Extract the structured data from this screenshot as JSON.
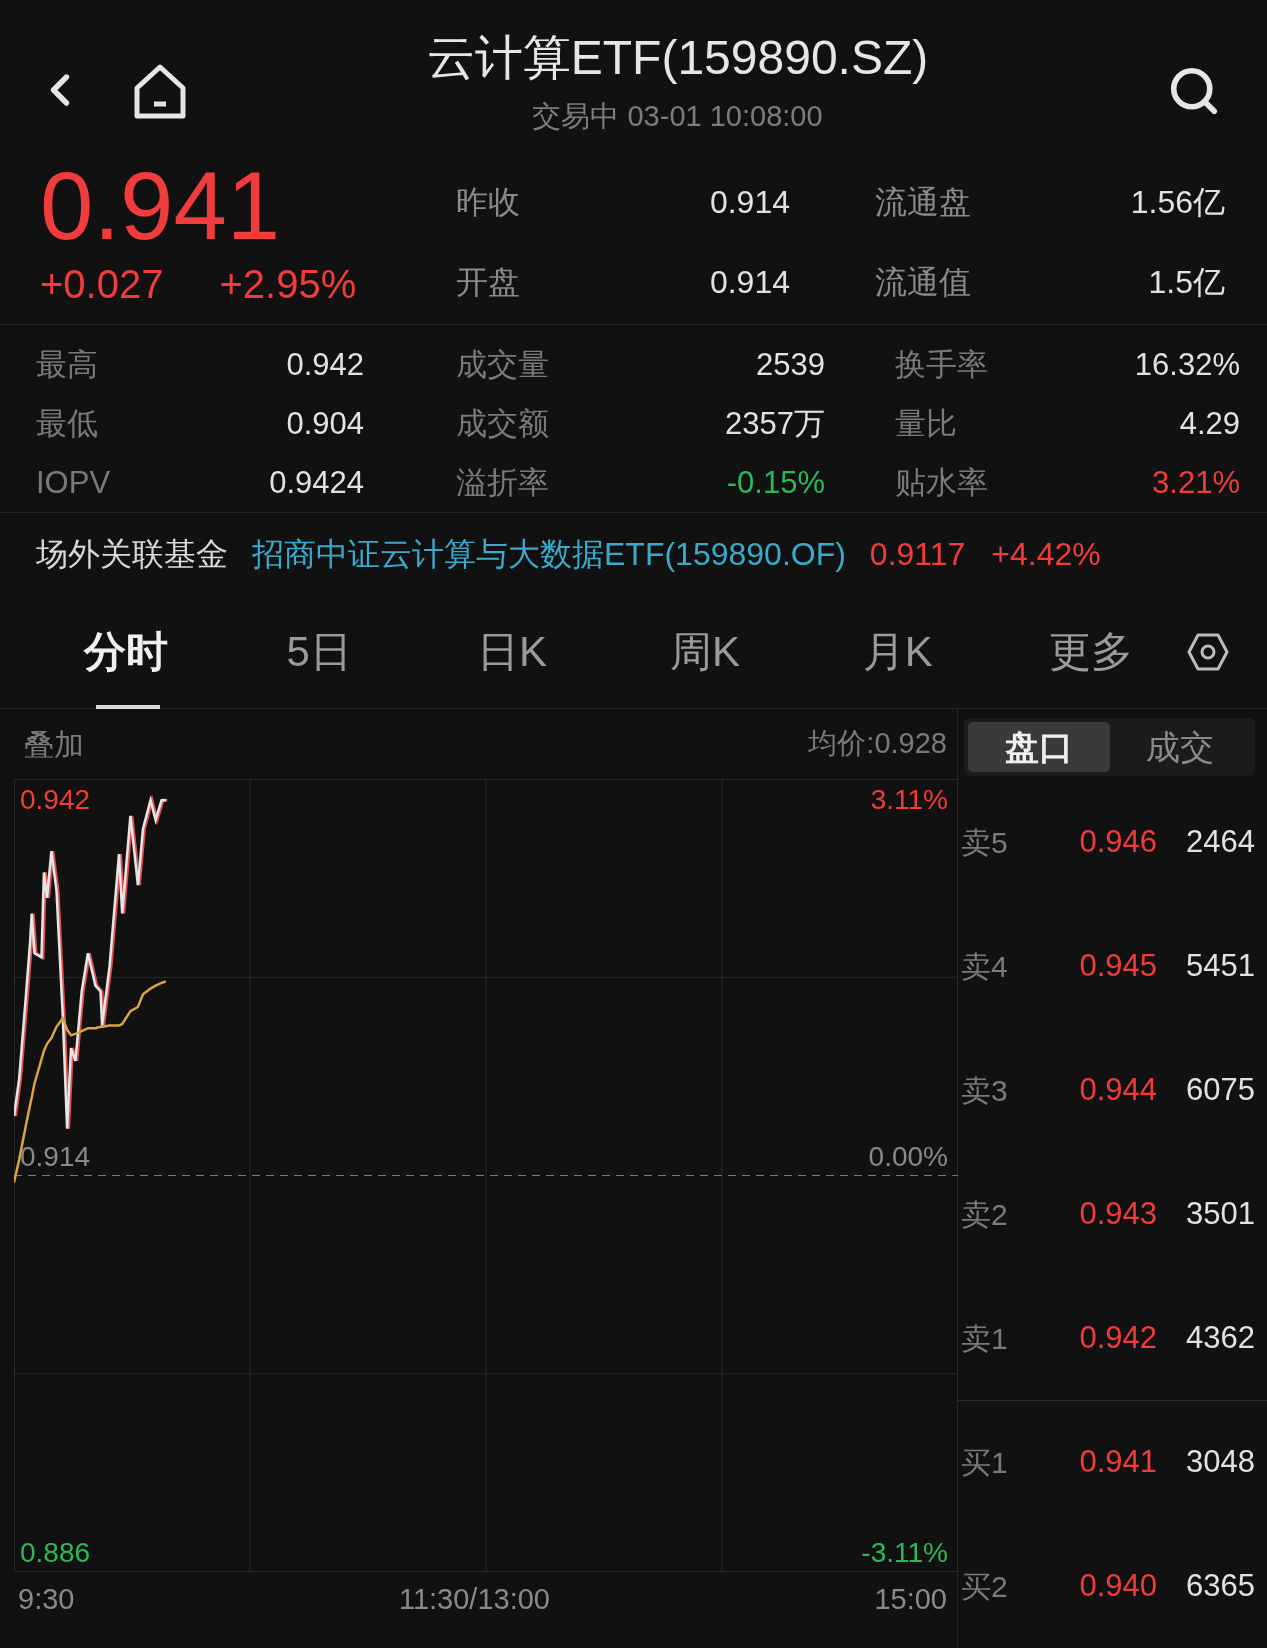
{
  "header": {
    "title": "云计算ETF(159890.SZ)",
    "status": "交易中 03-01 10:08:00"
  },
  "quote": {
    "price": "0.941",
    "change": "+0.027",
    "change_pct": "+2.95%",
    "color": "#f03c3c"
  },
  "summary_rows": [
    {
      "cells": [
        {
          "label": "昨收",
          "value": "0.914",
          "color": "#e2e2e2"
        },
        {
          "label": "流通盘",
          "value": "1.56亿",
          "color": "#e2e2e2"
        }
      ]
    },
    {
      "cells": [
        {
          "label": "开盘",
          "value": "0.914",
          "color": "#e2e2e2"
        },
        {
          "label": "流通值",
          "value": "1.5亿",
          "color": "#e2e2e2"
        }
      ]
    }
  ],
  "detail_rows": [
    {
      "cells": [
        {
          "label": "最高",
          "value": "0.942",
          "color": "#e2e2e2"
        },
        {
          "label": "成交量",
          "value": "2539",
          "color": "#e2e2e2"
        },
        {
          "label": "换手率",
          "value": "16.32%",
          "color": "#e2e2e2"
        }
      ]
    },
    {
      "cells": [
        {
          "label": "最低",
          "value": "0.904",
          "color": "#e2e2e2"
        },
        {
          "label": "成交额",
          "value": "2357万",
          "color": "#e2e2e2"
        },
        {
          "label": "量比",
          "value": "4.29",
          "color": "#e2e2e2"
        }
      ]
    },
    {
      "cells": [
        {
          "label": "IOPV",
          "value": "0.9424",
          "color": "#e2e2e2"
        },
        {
          "label": "溢折率",
          "value": "-0.15%",
          "color": "#2cb957"
        },
        {
          "label": "贴水率",
          "value": "3.21%",
          "color": "#f03c3c"
        }
      ]
    }
  ],
  "linked_fund": {
    "label": "场外关联基金",
    "name": "招商中证云计算与大数据ETF(159890.OF)",
    "price": "0.9117",
    "change": "+4.42%"
  },
  "tabs": [
    {
      "label": "分时",
      "selected": true
    },
    {
      "label": "5日",
      "selected": false
    },
    {
      "label": "日K",
      "selected": false
    },
    {
      "label": "周K",
      "selected": false
    },
    {
      "label": "月K",
      "selected": false
    },
    {
      "label": "更多",
      "selected": false
    }
  ],
  "chart": {
    "overlay_label": "叠加",
    "avg_price": "均价:0.928",
    "price_labels": [
      "0.942",
      "0.914",
      "0.886"
    ],
    "percent_labels": [
      "3.11%",
      "0.00%",
      "-3.11%"
    ],
    "time_labels": [
      "9:30",
      "11:30/13:00",
      "15:00"
    ]
  },
  "order_book": {
    "tabs": [
      {
        "label": "盘口",
        "selected": true
      },
      {
        "label": "成交",
        "selected": false
      }
    ],
    "sell_levels": [
      {
        "label": "卖5",
        "price": "0.946",
        "volume": "2464"
      },
      {
        "label": "卖4",
        "price": "0.945",
        "volume": "5451"
      },
      {
        "label": "卖3",
        "price": "0.944",
        "volume": "6075"
      },
      {
        "label": "卖2",
        "price": "0.943",
        "volume": "3501"
      },
      {
        "label": "卖1",
        "price": "0.942",
        "volume": "4362"
      }
    ],
    "buy_levels": [
      {
        "label": "买1",
        "price": "0.941",
        "volume": "3048"
      },
      {
        "label": "买2",
        "price": "0.940",
        "volume": "6365"
      }
    ]
  }
}
